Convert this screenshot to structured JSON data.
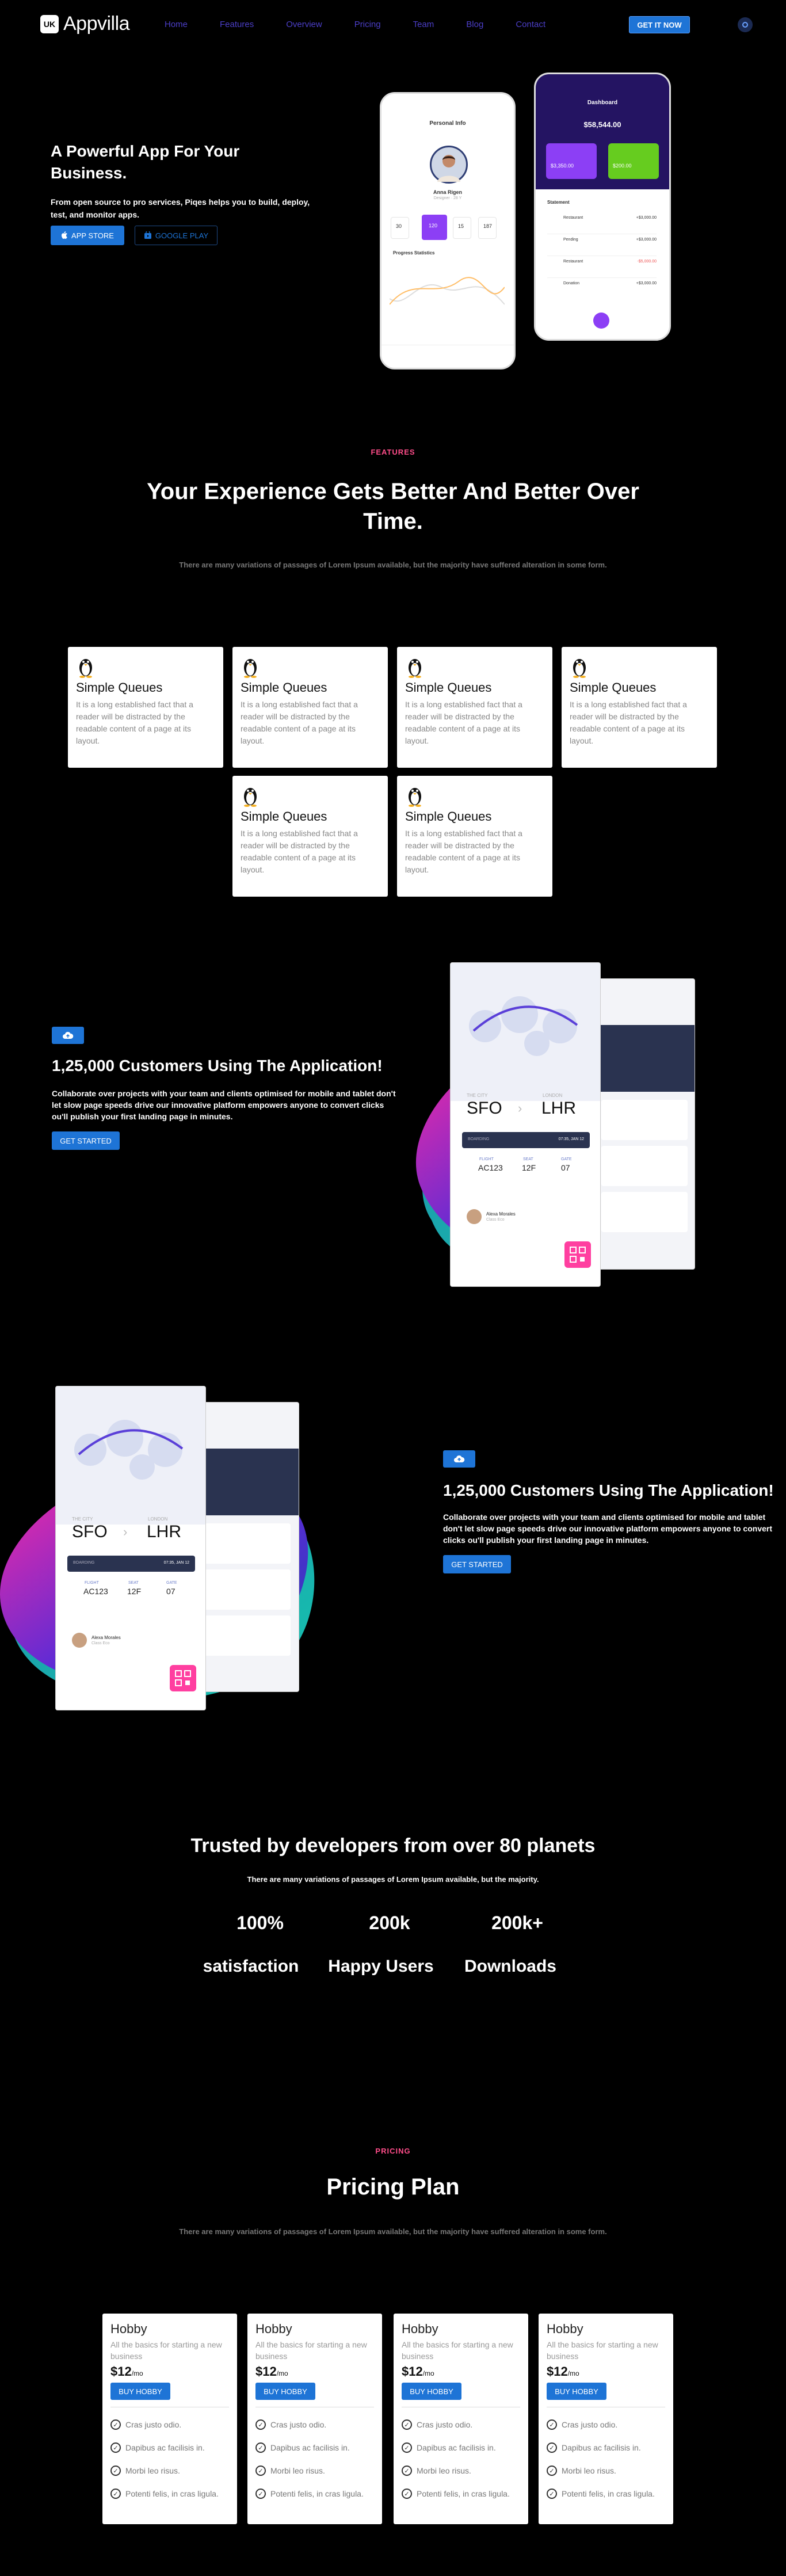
{
  "nav": {
    "logo_badge": "UK",
    "logo_text": "Appvilla",
    "links": [
      "Home",
      "Features",
      "Overview",
      "Pricing",
      "Team",
      "Blog",
      "Contact"
    ],
    "cta": "GET IT NOW",
    "toggle_icon": "settings-icon"
  },
  "hero": {
    "title": "A Powerful App For Your Business.",
    "subtitle": "From open source to pro services, Piqes helps you to build, deploy, test, and monitor apps.",
    "app_store": "APP STORE",
    "google_play": "GOOGLE PLAY"
  },
  "phone_left": {
    "header": "Personal Info",
    "name": "Anna Rigen",
    "role": "Designer · 28 Y",
    "stats": [
      "30",
      "120",
      "15",
      "187"
    ],
    "section": "Progress Statistics"
  },
  "phone_right": {
    "header": "Dashboard",
    "balance": "$58,544.00",
    "card_a": "$3,350.00",
    "card_b": "$200.00",
    "section": "Statement",
    "rows": [
      {
        "label": "Restaurant",
        "amount": "+$3,000.00"
      },
      {
        "label": "Pending",
        "amount": "+$3,000.00"
      },
      {
        "label": "Restaurant",
        "amount": "-$5,000.00"
      },
      {
        "label": "Donation",
        "amount": "+$3,000.00"
      }
    ]
  },
  "features": {
    "label": "FEATURES",
    "title": "Your Experience Gets Better And Better Over Time.",
    "description": "There are many variations of passages of Lorem Ipsum available, but the majority have suffered alteration in some form.",
    "cards": [
      {
        "title": "Simple Queues",
        "text": "It is a long established fact that a reader will be distracted by the readable content of a page at its layout."
      },
      {
        "title": "Simple Queues",
        "text": "It is a long established fact that a reader will be distracted by the readable content of a page at its layout."
      },
      {
        "title": "Simple Queues",
        "text": "It is a long established fact that a reader will be distracted by the readable content of a page at its layout."
      },
      {
        "title": "Simple Queues",
        "text": "It is a long established fact that a reader will be distracted by the readable content of a page at its layout."
      },
      {
        "title": "Simple Queues",
        "text": "It is a long established fact that a reader will be distracted by the readable content of a page at its layout."
      },
      {
        "title": "Simple Queues",
        "text": "It is a long established fact that a reader will be distracted by the readable content of a page at its layout."
      }
    ]
  },
  "showcase": {
    "title": "1,25,000 Customers Using The Application!",
    "text": "Collaborate over projects with your team and clients optimised for mobile and tablet don't let slow page speeds drive our innovative platform empowers anyone to convert clicks ou'll publish your first landing page in minutes.",
    "cta": "GET STARTED",
    "flight": {
      "from_city": "THE CITY",
      "from": "SFO",
      "to_city": "LONDON",
      "to": "LHR",
      "boarding": "BOARDING",
      "time": "07:35, JAN 12",
      "flight_lbl": "FLIGHT",
      "flight_no": "AC123",
      "seat_lbl": "SEAT",
      "seat": "12F",
      "gate_lbl": "GATE",
      "gate": "07",
      "passenger": "Alexa Morales",
      "class": "Class Eco"
    }
  },
  "stats": {
    "title": "Trusted by developers from over 80 planets",
    "subtitle": "There are many variations of passages of Lorem Ipsum available, but the majority.",
    "items": [
      {
        "value": "100%",
        "label": "satisfaction"
      },
      {
        "value": "200k",
        "label": "Happy Users"
      },
      {
        "value": "200k+",
        "label": "Downloads"
      }
    ]
  },
  "pricing": {
    "label": "PRICING",
    "title": "Pricing Plan",
    "description": "There are many variations of passages of Lorem Ipsum available, but the majority have suffered alteration in some form.",
    "plans": [
      {
        "name": "Hobby",
        "desc": "All the basics for starting a new business",
        "price": "$12",
        "period": "/mo",
        "cta": "BUY HOBBY",
        "features": [
          "Cras justo odio.",
          "Dapibus ac facilisis in.",
          "Morbi leo risus.",
          "Potenti felis, in cras ligula."
        ]
      },
      {
        "name": "Hobby",
        "desc": "All the basics for starting a new business",
        "price": "$12",
        "period": "/mo",
        "cta": "BUY HOBBY",
        "features": [
          "Cras justo odio.",
          "Dapibus ac facilisis in.",
          "Morbi leo risus.",
          "Potenti felis, in cras ligula."
        ]
      },
      {
        "name": "Hobby",
        "desc": "All the basics for starting a new business",
        "price": "$12",
        "period": "/mo",
        "cta": "BUY HOBBY",
        "features": [
          "Cras justo odio.",
          "Dapibus ac facilisis in.",
          "Morbi leo risus.",
          "Potenti felis, in cras ligula."
        ]
      },
      {
        "name": "Hobby",
        "desc": "All the basics for starting a new business",
        "price": "$12",
        "period": "/mo",
        "cta": "BUY HOBBY",
        "features": [
          "Cras justo odio.",
          "Dapibus ac facilisis in.",
          "Morbi leo risus.",
          "Potenti felis, in cras ligula."
        ]
      }
    ]
  },
  "colors": {
    "background": "#000000",
    "accent": "#1e74d6",
    "section_label": "#ff4d8a",
    "nav_link": "#4c3fc9"
  }
}
